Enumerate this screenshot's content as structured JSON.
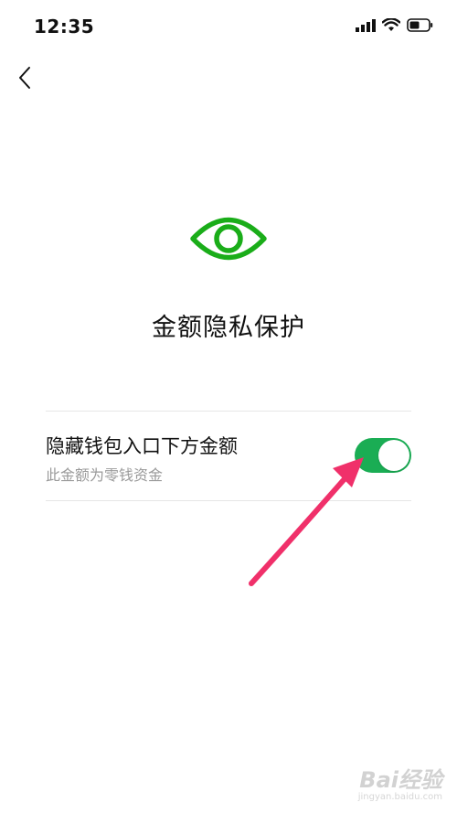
{
  "status_bar": {
    "time": "12:35",
    "icons": [
      "signal-icon",
      "wifi-icon",
      "battery-icon"
    ]
  },
  "nav": {
    "back_icon": "chevron-left-icon"
  },
  "main": {
    "icon": "eye-icon",
    "title": "金额隐私保护"
  },
  "setting": {
    "label": "隐藏钱包入口下方金额",
    "description": "此金额为零钱资金",
    "toggle_on": true
  },
  "watermark": {
    "logo": "Bai经验",
    "sub": "jingyan.baidu.com"
  },
  "colors": {
    "accent": "#1aad54",
    "eye": "#1aad19",
    "arrow": "#f0306a",
    "divider": "#e6e6e6",
    "secondary_text": "#9a9a9a"
  }
}
